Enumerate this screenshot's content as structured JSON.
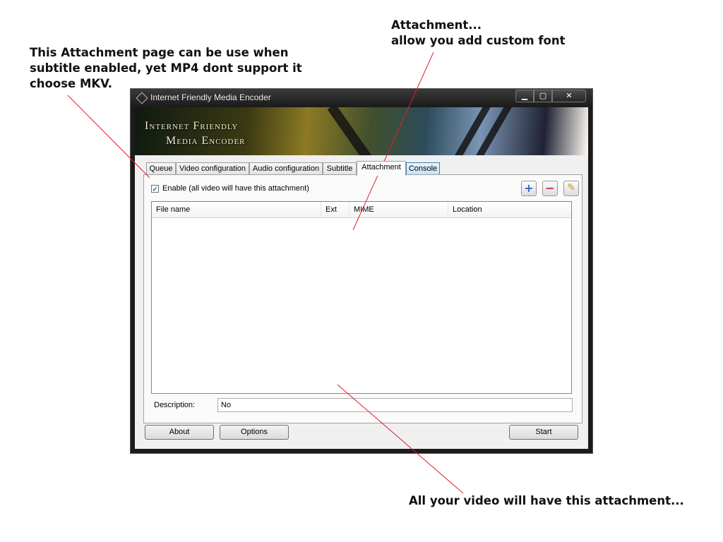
{
  "annotations": {
    "left_note": "This Attachment page can be use when\nsubtitle enabled, yet MP4 dont support it\nchoose MKV.",
    "top_note": "Attachment...\nallow you add custom font",
    "bottom_note": "All your video will have this attachment..."
  },
  "window": {
    "title": "Internet Friendly Media Encoder",
    "controls": {
      "minimize": "▁",
      "maximize": "▢",
      "close": "✕"
    }
  },
  "banner": {
    "title": "Internet Friendly\n      Media Encoder"
  },
  "tabs": [
    {
      "label": "Queue"
    },
    {
      "label": "Video configuration"
    },
    {
      "label": "Audio configuration"
    },
    {
      "label": "Subtitle"
    },
    {
      "label": "Attachment",
      "active": true
    },
    {
      "label": "Console"
    }
  ],
  "attachment": {
    "enable_checked": true,
    "check_mark": "✓",
    "enable_label": "Enable (all video will have this attachment)",
    "tools": [
      {
        "name": "add",
        "icon": "plus-icon",
        "glyph": "+"
      },
      {
        "name": "remove",
        "icon": "minus-icon",
        "glyph": "−"
      },
      {
        "name": "clear",
        "icon": "broom-icon",
        "glyph": "✎"
      }
    ],
    "columns": [
      "File name",
      "Ext",
      "MIME",
      "Location"
    ],
    "rows": [],
    "description_label": "Description:",
    "description_value": "No"
  },
  "buttons": {
    "about": "About",
    "options": "Options",
    "start": "Start"
  },
  "colors": {
    "accent_tab": "#c3e2f6",
    "window_frame": "#1b1b1b",
    "annotation_line": "#e0202a"
  }
}
